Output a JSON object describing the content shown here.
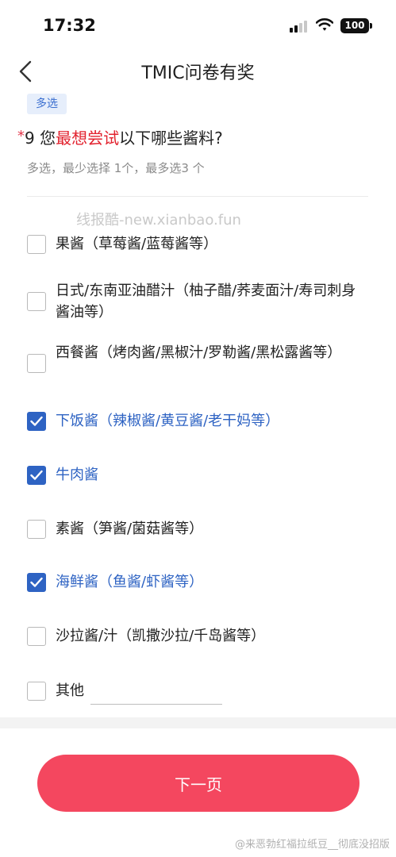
{
  "status_bar": {
    "time": "17:32",
    "battery": "100"
  },
  "nav": {
    "title": "TMIC问卷有奖"
  },
  "question": {
    "badge": "多选",
    "required_mark": "*",
    "title_prefix": "9 您",
    "title_highlight": "最想尝试",
    "title_suffix": "以下哪些酱料?",
    "hint": "多选，最少选择 1个，最多选3 个"
  },
  "watermark": "线报酷-new.xianbao.fun",
  "options": [
    {
      "label": "果酱（草莓酱/蓝莓酱等）",
      "checked": false
    },
    {
      "label": "日式/东南亚油醋汁（柚子醋/荞麦面汁/寿司刺身酱油等）",
      "checked": false
    },
    {
      "label": "西餐酱（烤肉酱/黑椒汁/罗勒酱/黑松露酱等）",
      "checked": false
    },
    {
      "label": "下饭酱（辣椒酱/黄豆酱/老干妈等）",
      "checked": true
    },
    {
      "label": "牛肉酱",
      "checked": true
    },
    {
      "label": "素酱（笋酱/菌菇酱等）",
      "checked": false
    },
    {
      "label": "海鲜酱（鱼酱/虾酱等）",
      "checked": true
    },
    {
      "label": "沙拉酱/汁（凯撒沙拉/千岛酱等）",
      "checked": false
    },
    {
      "label": "其他",
      "checked": false
    }
  ],
  "next_button": "下一页",
  "bottom_watermark": "@来恶勃红福拉纸豆__彻底没招版",
  "colors": {
    "accent": "#2e63c3",
    "button": "#f4475f",
    "highlight": "#e2232f"
  }
}
